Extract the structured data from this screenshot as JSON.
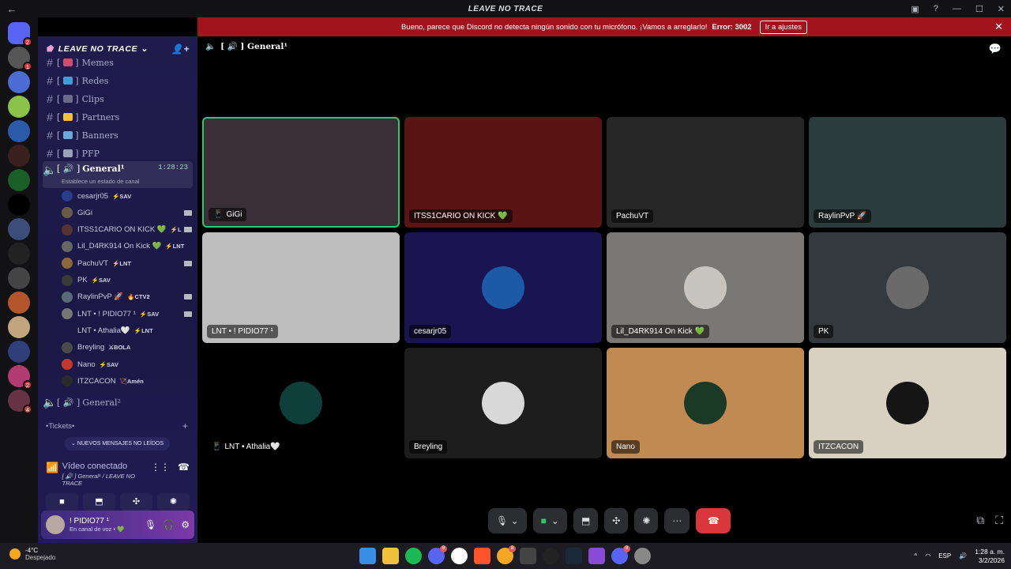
{
  "window": {
    "title": "LEAVE NO TRACE",
    "back": "←"
  },
  "notice": {
    "text": "Bueno, parece que Discord no detecta ningún sonido con tu micrófono. ¡Vamos a arreglarlo!",
    "error": "Error: 3002",
    "button": "Ir a ajustes",
    "close": "✕"
  },
  "guilds": [
    {
      "color": "#5865f2",
      "badge": "2"
    },
    {
      "color": "#555",
      "badge": "1"
    },
    {
      "color": "#4a6cd4",
      "badge": ""
    },
    {
      "color": "#8bc34a",
      "badge": ""
    },
    {
      "color": "#2b5aa8",
      "badge": ""
    },
    {
      "color": "#3a1f1f",
      "badge": ""
    },
    {
      "color": "#1c5e2a",
      "badge": ""
    },
    {
      "color": "#000",
      "badge": ""
    },
    {
      "color": "#3b4e7a",
      "badge": ""
    },
    {
      "color": "#222",
      "badge": ""
    },
    {
      "color": "#444",
      "badge": ""
    },
    {
      "color": "#b3552a",
      "badge": ""
    },
    {
      "color": "#c2a57c",
      "badge": ""
    },
    {
      "color": "#2e3f7a",
      "badge": ""
    },
    {
      "color": "#b23b72",
      "badge": "2"
    },
    {
      "color": "#663344",
      "badge": "4"
    }
  ],
  "server": {
    "name": "LEAVE NO TRACE",
    "chevron": "⌄",
    "invite_icon": "person-add-icon"
  },
  "channels": [
    {
      "name": "Memes",
      "emoji_color": "#d84a6a"
    },
    {
      "name": "Redes",
      "emoji_color": "#3aa0d8"
    },
    {
      "name": "Clips",
      "emoji_color": "#6a6a8a"
    },
    {
      "name": "Partners",
      "emoji_color": "#f0c23b"
    },
    {
      "name": "Banners",
      "emoji_color": "#6fa8d8"
    },
    {
      "name": "PFP",
      "emoji_color": "#9aa0b8"
    }
  ],
  "voice_channel": {
    "name": "General¹",
    "prefix": "[ 🔊 ]",
    "time": "1:28:23",
    "status": "Establece un estado de canal"
  },
  "voice_users": [
    {
      "name": "cesarjr05",
      "tag": "⚡SAV",
      "av": "#2b3c8a",
      "cam": false
    },
    {
      "name": "GiGi",
      "tag": "",
      "av": "#6a5a4a",
      "cam": true
    },
    {
      "name": "ITSS1CARIO ON KICK 💚",
      "tag": "⚡L",
      "av": "#553333",
      "cam": true
    },
    {
      "name": "Lil_D4RK914 On Kick 💚",
      "tag": "⚡LNT",
      "av": "#666",
      "cam": false
    },
    {
      "name": "PachuVT",
      "tag": "⚡LNT",
      "av": "#8a6a3a",
      "cam": true
    },
    {
      "name": "PK",
      "tag": "⚡SAV",
      "av": "#3a3a3a",
      "cam": false
    },
    {
      "name": "RaylinPvP 🚀",
      "tag": "🔥CTV2",
      "av": "#5a6a7a",
      "cam": true
    },
    {
      "name": "LNT • ! PIDIO77 ¹",
      "tag": "⚡SAV",
      "av": "#777",
      "cam": true
    },
    {
      "name": "LNT • Athalia🤍",
      "tag": "⚡LNT",
      "av": "#1b1845",
      "cam": false
    },
    {
      "name": "Breyling",
      "tag": "⚔BOLA",
      "av": "#4a4a4a",
      "cam": false
    },
    {
      "name": "Nano",
      "tag": "⚡SAV",
      "av": "#c0392b",
      "cam": false
    },
    {
      "name": "ITZCACON",
      "tag": "🏹Amén",
      "av": "#2a2a2a",
      "cam": false
    }
  ],
  "voice_channel2": {
    "name": "General²",
    "prefix": "[ 🔊 ]"
  },
  "category": {
    "name": "•Tickets•",
    "add": "+"
  },
  "unread_pill": "NUEVOS MENSAJES NO LEÍDOS",
  "vc_panel": {
    "status": "Vídeo conectado",
    "location": "[ 🔊 ] General¹ / LEAVE NO TRACE"
  },
  "user": {
    "name": "! PIDIO77 ¹",
    "status": "En canal de voz • 💚"
  },
  "stage_title": "[ 🔊 ] General¹",
  "tiles": [
    {
      "name": "GiGi",
      "bg": "#3a2f36",
      "speaking": true,
      "pfp": "",
      "prefix": "📱"
    },
    {
      "name": "ITSS1CARIO ON KICK 💚",
      "bg": "#5a1414",
      "speaking": false,
      "pfp": "",
      "prefix": ""
    },
    {
      "name": "PachuVT",
      "bg": "#262626",
      "speaking": false,
      "pfp": "",
      "prefix": ""
    },
    {
      "name": "RaylinPvP 🚀",
      "bg": "#2c3c3c",
      "speaking": false,
      "pfp": "",
      "prefix": ""
    },
    {
      "name": "LNT • ! PIDIO77 ¹",
      "bg": "#bdbdbd",
      "speaking": false,
      "pfp": "",
      "prefix": ""
    },
    {
      "name": "cesarjr05",
      "bg": "#1a1450",
      "speaking": false,
      "pfp": "#1c5aa8",
      "prefix": ""
    },
    {
      "name": "Lil_D4RK914 On Kick 💚",
      "bg": "#7a7874",
      "speaking": false,
      "pfp": "#c8c4bf",
      "prefix": ""
    },
    {
      "name": "PK",
      "bg": "#33393d",
      "speaking": false,
      "pfp": "#6a6a6a",
      "prefix": ""
    },
    {
      "name": "LNT • Athalia🤍",
      "bg": "#000000",
      "speaking": false,
      "pfp": "#0f3f3a",
      "prefix": "📱"
    },
    {
      "name": "Breyling",
      "bg": "#1d1d1d",
      "speaking": false,
      "pfp": "#d8d8d8",
      "prefix": ""
    },
    {
      "name": "Nano",
      "bg": "#c08a52",
      "speaking": false,
      "pfp": "#1b3a26",
      "prefix": ""
    },
    {
      "name": "ITZCACON",
      "bg": "#d8d0c0",
      "speaking": false,
      "pfp": "#151515",
      "prefix": ""
    }
  ],
  "weather": {
    "temp": "-4°C",
    "desc": "Despejado"
  },
  "tray": {
    "lang": "ESP",
    "time": "1:28 a. m.",
    "date": "3/2/2026"
  }
}
